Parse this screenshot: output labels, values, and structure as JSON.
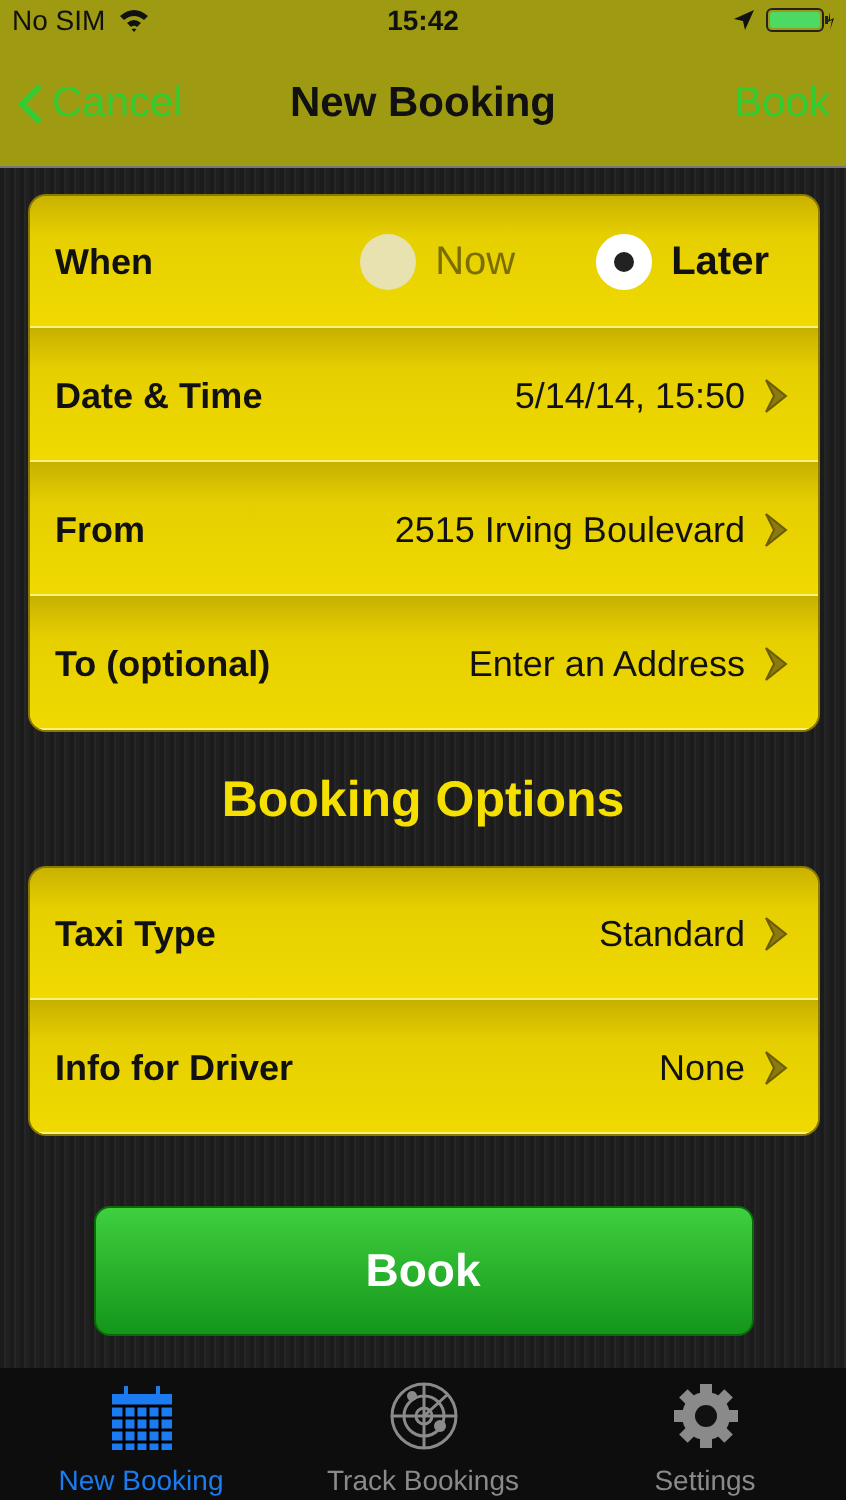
{
  "status_bar": {
    "carrier": "No SIM",
    "time": "15:42"
  },
  "nav": {
    "back": "Cancel",
    "title": "New Booking",
    "action": "Book"
  },
  "trip": [
    {
      "kind": "choice",
      "label": "When",
      "options": [
        {
          "label": "Now",
          "selected": false
        },
        {
          "label": "Later",
          "selected": true
        }
      ]
    },
    {
      "kind": "link",
      "label": "Date & Time",
      "value": "5/14/14, 15:50"
    },
    {
      "kind": "link",
      "label": "From",
      "value": "2515 Irving Boulevard"
    },
    {
      "kind": "link",
      "label": "To (optional)",
      "value": "Enter an Address"
    }
  ],
  "options_heading": "Booking Options",
  "options": [
    {
      "kind": "link",
      "label": "Taxi Type",
      "value": "Standard"
    },
    {
      "kind": "link",
      "label": "Info for Driver",
      "value": "None"
    }
  ],
  "book_button": "Book",
  "tabs": [
    {
      "kind": "calendar",
      "label": "New Booking",
      "selected": true
    },
    {
      "kind": "radar",
      "label": "Track Bookings",
      "selected": false
    },
    {
      "kind": "gear",
      "label": "Settings",
      "selected": false
    }
  ]
}
